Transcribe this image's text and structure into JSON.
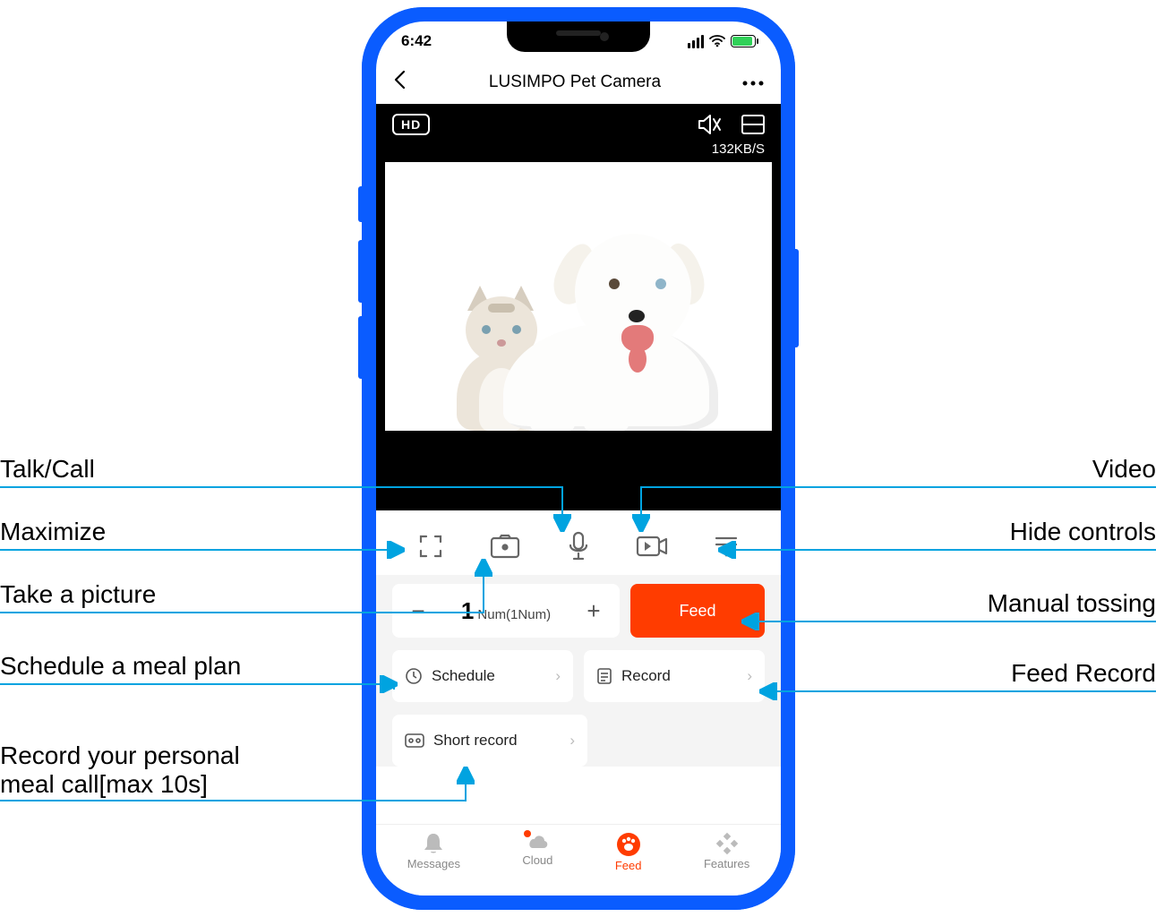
{
  "status_bar": {
    "time": "6:42"
  },
  "nav": {
    "title": "LUSIMPO Pet Camera"
  },
  "video": {
    "hd_label": "HD",
    "bitrate": "132KB/S"
  },
  "feed_panel": {
    "qty_value": "1",
    "qty_unit": "Num(1Num)",
    "feed_label": "Feed"
  },
  "cards": {
    "schedule": "Schedule",
    "record": "Record",
    "short_record": "Short record"
  },
  "tabs": {
    "messages": "Messages",
    "cloud": "Cloud",
    "feed": "Feed",
    "features": "Features"
  },
  "callouts": {
    "talk": "Talk/Call",
    "maximize": "Maximize",
    "picture": "Take a picture",
    "schedule": "Schedule a meal plan",
    "short_record": "Record your personal\nmeal call[max 10s]",
    "video": "Video",
    "hide": "Hide controls",
    "tossing": "Manual tossing",
    "feed_record": "Feed Record"
  }
}
